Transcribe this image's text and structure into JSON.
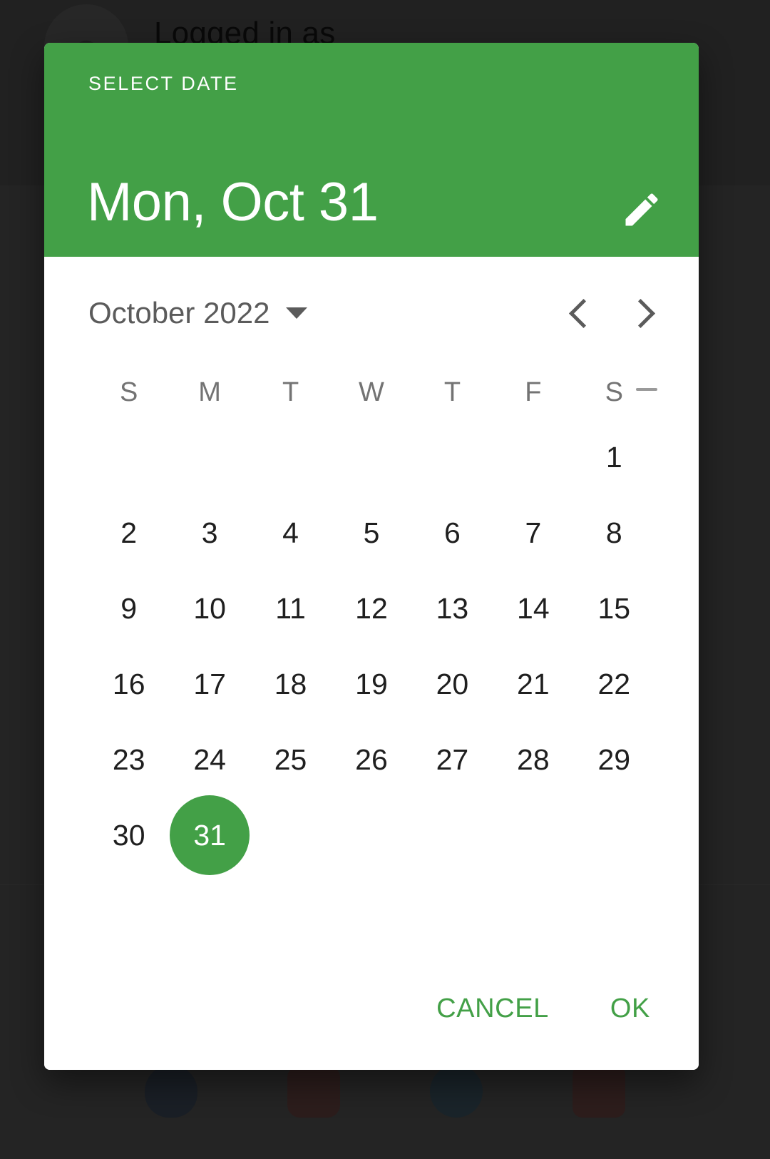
{
  "backdrop": {
    "logged_in_text": "Logged in as",
    "avatar_icon": "person-avatar-icon",
    "scrim_color": "#353535",
    "bottom_icons": [
      "app-icon-1",
      "app-icon-2",
      "app-icon-3",
      "app-icon-4"
    ]
  },
  "dialog": {
    "accent_color": "#43A047",
    "header": {
      "eyebrow": "SELECT DATE",
      "selected_date_long": "Mon, Oct 31",
      "edit_icon": "pencil-edit-icon"
    },
    "nav": {
      "month_year_label": "October 2022",
      "dropdown_icon": "caret-down-icon",
      "prev_icon": "chevron-left-icon",
      "next_icon": "chevron-right-icon"
    },
    "calendar": {
      "weekday_headers": [
        "S",
        "M",
        "T",
        "W",
        "T",
        "F",
        "S"
      ],
      "weeks": [
        [
          "",
          "",
          "",
          "",
          "",
          "",
          "1"
        ],
        [
          "2",
          "3",
          "4",
          "5",
          "6",
          "7",
          "8"
        ],
        [
          "9",
          "10",
          "11",
          "12",
          "13",
          "14",
          "15"
        ],
        [
          "16",
          "17",
          "18",
          "19",
          "20",
          "21",
          "22"
        ],
        [
          "23",
          "24",
          "25",
          "26",
          "27",
          "28",
          "29"
        ],
        [
          "30",
          "31",
          "",
          "",
          "",
          "",
          ""
        ]
      ],
      "selected_day": "31",
      "selected_week_index": 5,
      "selected_col_index": 1
    },
    "actions": {
      "cancel_label": "CANCEL",
      "ok_label": "OK"
    }
  }
}
